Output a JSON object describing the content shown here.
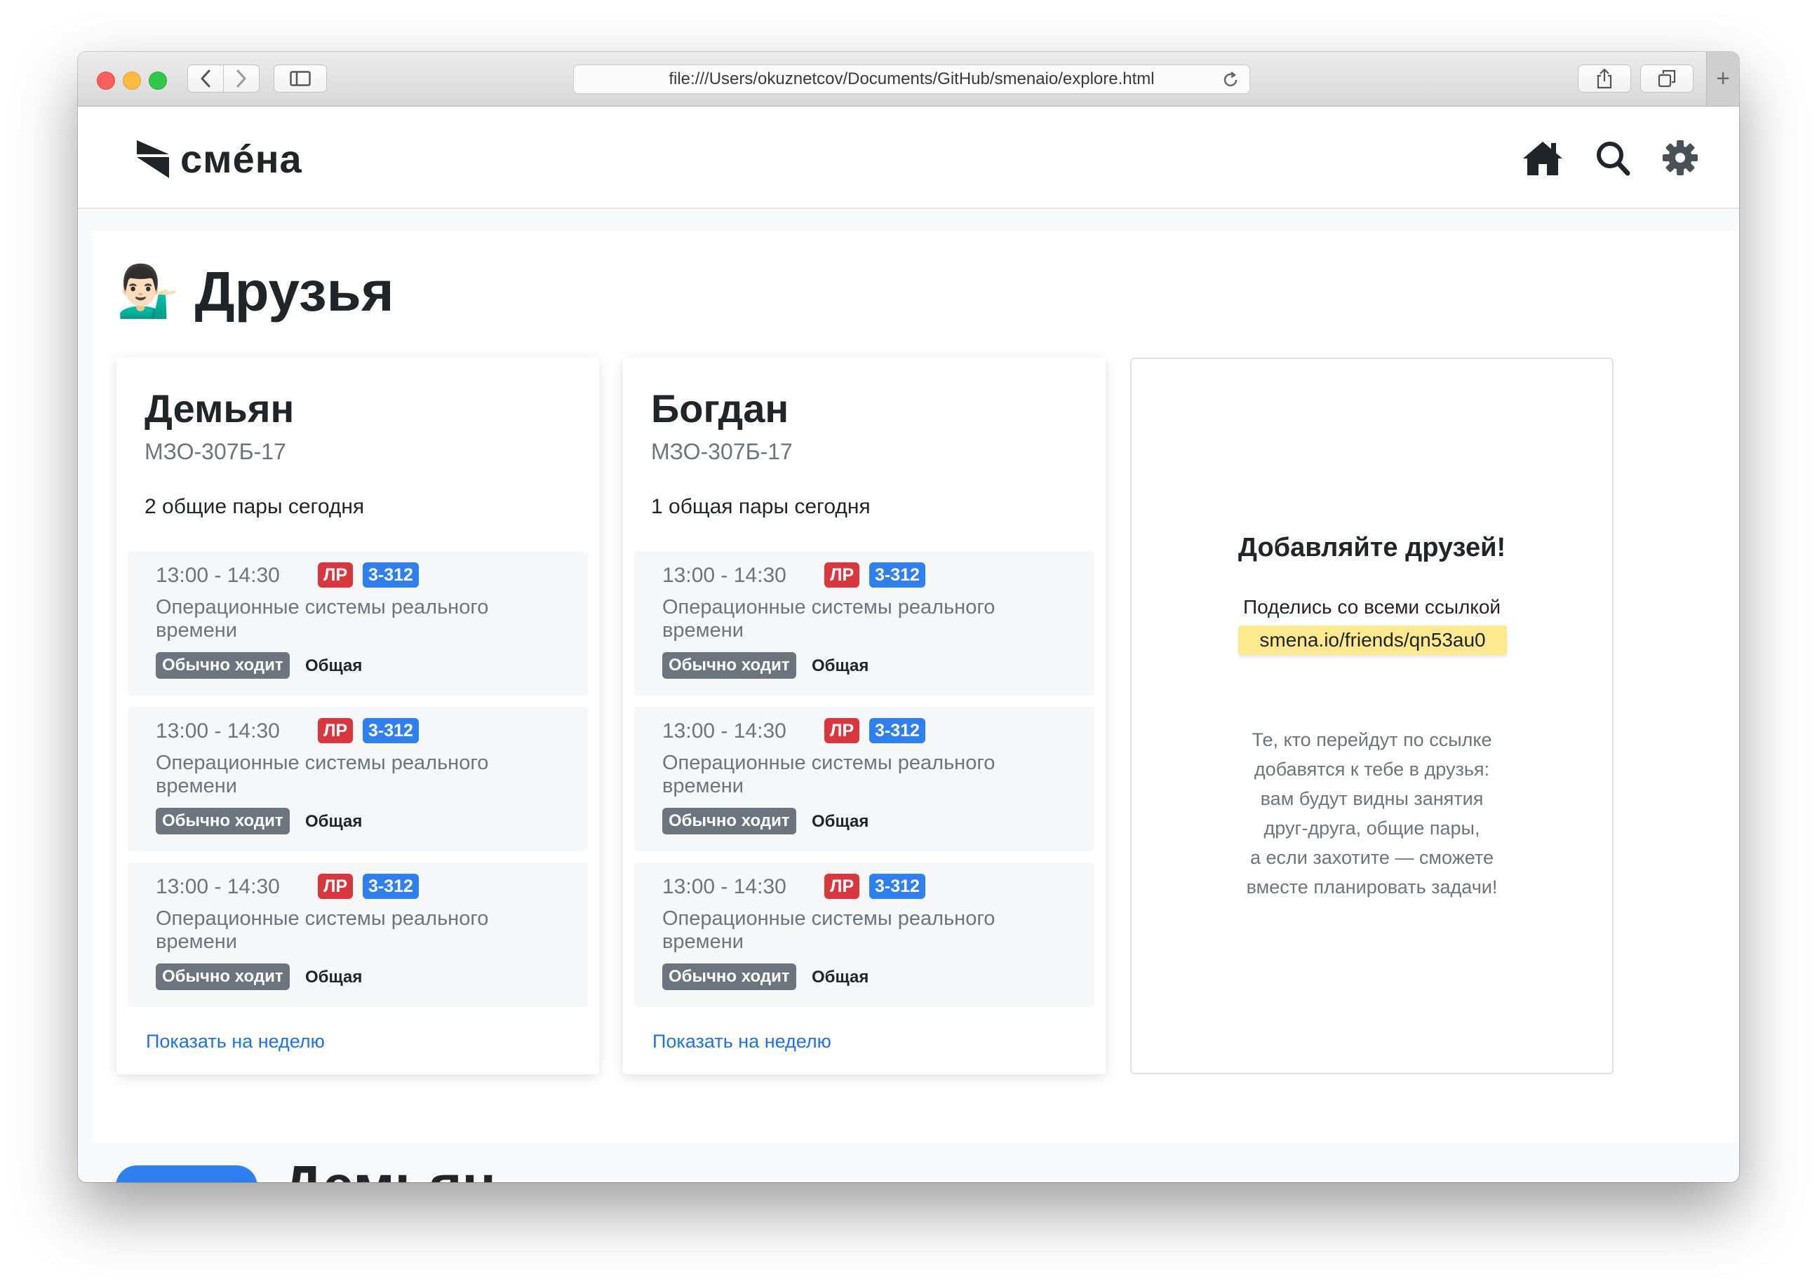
{
  "browser": {
    "url": "file:///Users/okuznetcov/Documents/GitHub/smenaio/explore.html",
    "new_tab_label": "+"
  },
  "navbar": {
    "brand": "смéна",
    "icons": [
      "home-icon",
      "search-icon",
      "gear-icon"
    ]
  },
  "page": {
    "emoji": "💁🏻‍♂️",
    "title": "Друзья"
  },
  "friends": [
    {
      "name": "Демьян",
      "group": "МЗО-307Б-17",
      "common_today": "2 общие пары сегодня",
      "lessons": [
        {
          "time": "13:00 - 14:30",
          "type": "ЛР",
          "room": "3-312",
          "title": "Операционные системы реального времени",
          "attendance": "Обычно ходит",
          "kind": "Общая"
        },
        {
          "time": "13:00 - 14:30",
          "type": "ЛР",
          "room": "3-312",
          "title": "Операционные системы реального времени",
          "attendance": "Обычно ходит",
          "kind": "Общая"
        },
        {
          "time": "13:00 - 14:30",
          "type": "ЛР",
          "room": "3-312",
          "title": "Операционные системы реального времени",
          "attendance": "Обычно ходит",
          "kind": "Общая"
        }
      ],
      "week_link": "Показать на неделю"
    },
    {
      "name": "Богдан",
      "group": "МЗО-307Б-17",
      "common_today": "1 общая пары сегодня",
      "lessons": [
        {
          "time": "13:00 - 14:30",
          "type": "ЛР",
          "room": "3-312",
          "title": "Операционные системы реального времени",
          "attendance": "Обычно ходит",
          "kind": "Общая"
        },
        {
          "time": "13:00 - 14:30",
          "type": "ЛР",
          "room": "3-312",
          "title": "Операционные системы реального времени",
          "attendance": "Обычно ходит",
          "kind": "Общая"
        },
        {
          "time": "13:00 - 14:30",
          "type": "ЛР",
          "room": "3-312",
          "title": "Операционные системы реального времени",
          "attendance": "Обычно ходит",
          "kind": "Общая"
        }
      ],
      "week_link": "Показать на неделю"
    }
  ],
  "invite": {
    "title": "Добавляйте друзей!",
    "share_text": "Поделись со всеми ссылкой",
    "link": "smena.io/friends/qn53au0",
    "description": [
      "Те, кто перейдут по ссылке",
      "добавятся к тебе в друзья:",
      "вам будут видны занятия",
      "друг-друга, общие пары,",
      "а если захотите — сможете",
      "вместе планировать задачи!"
    ]
  },
  "next_section": {
    "name": "Демьян"
  },
  "colors": {
    "lab_tag": "#d9363e",
    "room_tag": "#2f7ff0",
    "attendance_badge": "#6c757d",
    "link": "#1f73e0",
    "highlight": "#fde98f"
  }
}
